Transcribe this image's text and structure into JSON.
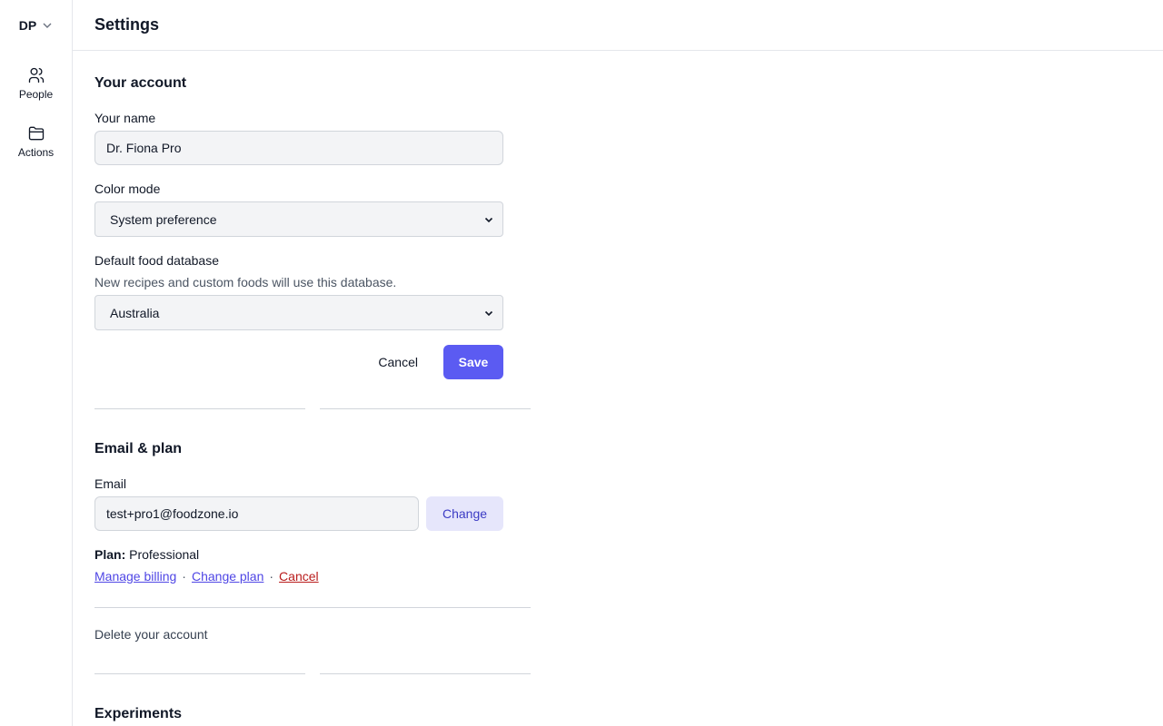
{
  "sidebar": {
    "account_initials": "DP",
    "items": [
      {
        "label": "People",
        "icon": "people-icon"
      },
      {
        "label": "Actions",
        "icon": "folder-icon"
      }
    ]
  },
  "header": {
    "title": "Settings"
  },
  "account": {
    "section_title": "Your account",
    "name_label": "Your name",
    "name_value": "Dr. Fiona Pro",
    "color_mode_label": "Color mode",
    "color_mode_value": "System preference",
    "food_db_label": "Default food database",
    "food_db_help": "New recipes and custom foods will use this database.",
    "food_db_value": "Australia",
    "cancel_label": "Cancel",
    "save_label": "Save"
  },
  "email_plan": {
    "section_title": "Email & plan",
    "email_label": "Email",
    "email_value": "test+pro1@foodzone.io",
    "change_label": "Change",
    "plan_prefix": "Plan:",
    "plan_value": "Professional",
    "links": {
      "manage_billing": "Manage billing",
      "change_plan": "Change plan",
      "cancel": "Cancel",
      "separator": "·"
    },
    "delete_label": "Delete your account"
  },
  "experiments": {
    "section_title": "Experiments"
  },
  "colors": {
    "primary": "#5b5bf2",
    "secondary_bg": "#e6e6fb",
    "link": "#4f46e5",
    "danger": "#b91c1c"
  }
}
